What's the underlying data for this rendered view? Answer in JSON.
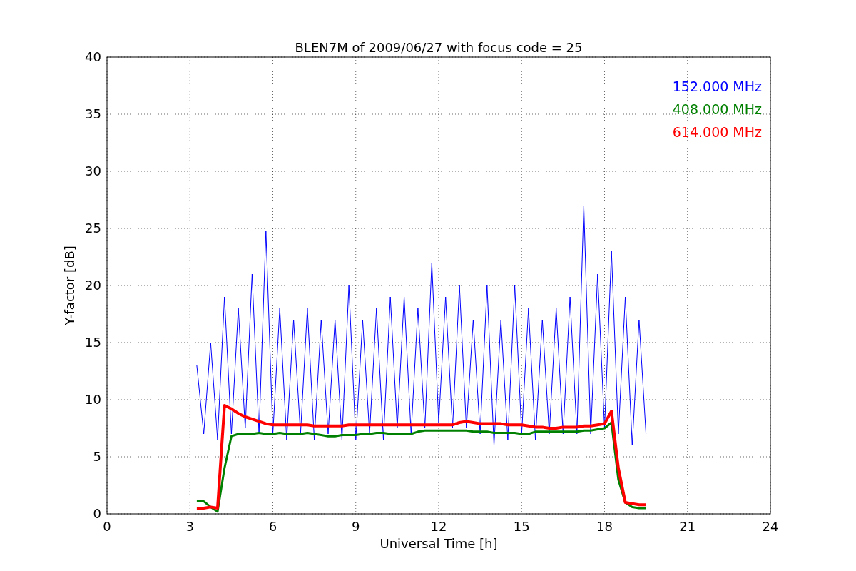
{
  "figure": {
    "chart_data": {
      "type": "line",
      "title": "BLEN7M of 2009/06/27 with focus code = 25",
      "xlabel": "Universal Time [h]",
      "ylabel": "Y-factor [dB]",
      "x": [
        3.25,
        3.5,
        3.75,
        4,
        4.25,
        4.5,
        4.75,
        5,
        5.25,
        5.5,
        5.75,
        6,
        6.25,
        6.5,
        6.75,
        7,
        7.25,
        7.5,
        7.75,
        8,
        8.25,
        8.5,
        8.75,
        9,
        9.25,
        9.5,
        9.75,
        10,
        10.25,
        10.5,
        10.75,
        11,
        11.25,
        11.5,
        11.75,
        12,
        12.25,
        12.5,
        12.75,
        13,
        13.25,
        13.5,
        13.75,
        14,
        14.25,
        14.5,
        14.75,
        15,
        15.25,
        15.5,
        15.75,
        16,
        16.25,
        16.5,
        16.75,
        17,
        17.25,
        17.5,
        17.75,
        18,
        18.25,
        18.5,
        18.75,
        19,
        19.25,
        19.5
      ],
      "series": [
        {
          "name": "152.000 MHz",
          "color": "#0000ff",
          "values": [
            13,
            7,
            15,
            6.5,
            19,
            7,
            18,
            7.5,
            21,
            7,
            24.8,
            7,
            18,
            6.5,
            17,
            7,
            18,
            6.5,
            17,
            7,
            17,
            6.5,
            20,
            6.5,
            17,
            7,
            18,
            6.5,
            19,
            7.5,
            19,
            7,
            18,
            7.5,
            22,
            8,
            19,
            7.5,
            20,
            7.5,
            17,
            7,
            20,
            6,
            17,
            6.5,
            20,
            7,
            18,
            6.5,
            17,
            7,
            18,
            7,
            19,
            7,
            27,
            7,
            21,
            7.5,
            23,
            7,
            19,
            6,
            17,
            7
          ]
        },
        {
          "name": "408.000 MHz",
          "color": "#008000",
          "values": [
            1.1,
            1.1,
            0.6,
            0.2,
            4,
            6.8,
            7,
            7,
            7,
            7.1,
            7,
            7,
            7.1,
            7,
            7,
            7,
            7.1,
            7,
            6.9,
            6.8,
            6.8,
            6.9,
            6.9,
            6.9,
            7,
            7,
            7.1,
            7.1,
            7,
            7,
            7,
            7,
            7.2,
            7.3,
            7.3,
            7.3,
            7.3,
            7.3,
            7.3,
            7.3,
            7.2,
            7.2,
            7.2,
            7.1,
            7.1,
            7.1,
            7.1,
            7,
            7,
            7.2,
            7.2,
            7.2,
            7.2,
            7.2,
            7.2,
            7.2,
            7.3,
            7.3,
            7.4,
            7.5,
            8,
            3,
            1,
            0.6,
            0.5,
            0.5
          ]
        },
        {
          "name": "614.000 MHz",
          "color": "#ff0000",
          "values": [
            0.5,
            0.5,
            0.6,
            0.5,
            9.5,
            9.2,
            8.8,
            8.5,
            8.3,
            8.1,
            7.9,
            7.8,
            7.8,
            7.8,
            7.8,
            7.8,
            7.8,
            7.7,
            7.7,
            7.7,
            7.7,
            7.7,
            7.8,
            7.8,
            7.8,
            7.8,
            7.8,
            7.8,
            7.8,
            7.8,
            7.8,
            7.8,
            7.8,
            7.8,
            7.8,
            7.8,
            7.8,
            7.8,
            8,
            8.1,
            8,
            7.9,
            7.9,
            7.9,
            7.9,
            7.8,
            7.8,
            7.8,
            7.7,
            7.6,
            7.6,
            7.5,
            7.5,
            7.6,
            7.6,
            7.6,
            7.7,
            7.7,
            7.8,
            7.9,
            9,
            4,
            1,
            0.9,
            0.8,
            0.8
          ]
        }
      ],
      "xlim": [
        0,
        24
      ],
      "ylim": [
        0,
        40
      ],
      "grid": true,
      "xticks": [
        0,
        3,
        6,
        9,
        12,
        15,
        18,
        21,
        24
      ],
      "yticks": [
        0,
        5,
        10,
        15,
        20,
        25,
        30,
        35,
        40
      ]
    }
  }
}
